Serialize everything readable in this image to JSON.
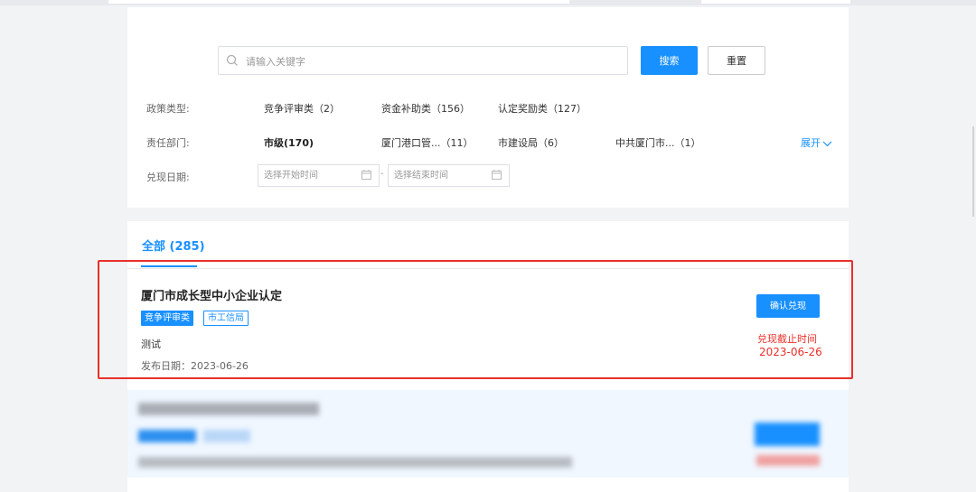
{
  "search": {
    "placeholder": "请输入关键字",
    "search_label": "搜索",
    "reset_label": "重置"
  },
  "filters": {
    "policy_type": {
      "label": "政策类型:",
      "options": [
        "竞争评审类（2）",
        "资金补助类（156）",
        "认定奖励类（127）"
      ]
    },
    "department": {
      "label": "责任部门:",
      "options": [
        "市级(170)",
        "厦门港口管...（11）",
        "市建设局（6）",
        "中共厦门市...（1）"
      ]
    },
    "expand_label": "展开",
    "date": {
      "label": "兑现日期:",
      "start_placeholder": "选择开始时间",
      "end_placeholder": "选择结束时间",
      "separator": "-"
    }
  },
  "tabs": {
    "all_label": "全部 (285)"
  },
  "cards": [
    {
      "title": "厦门市成长型中小企业认定",
      "tags": [
        "竞争评审类",
        "市工信局"
      ],
      "description": "测试",
      "publish_date": "发布日期：2023-06-26",
      "action_label": "确认兑现",
      "deadline_label": "兑现截止时间",
      "deadline_date": "2023-06-26"
    }
  ],
  "colors": {
    "accent": "#1890ff",
    "danger": "#e8302a",
    "background": "#f2f3f5"
  }
}
